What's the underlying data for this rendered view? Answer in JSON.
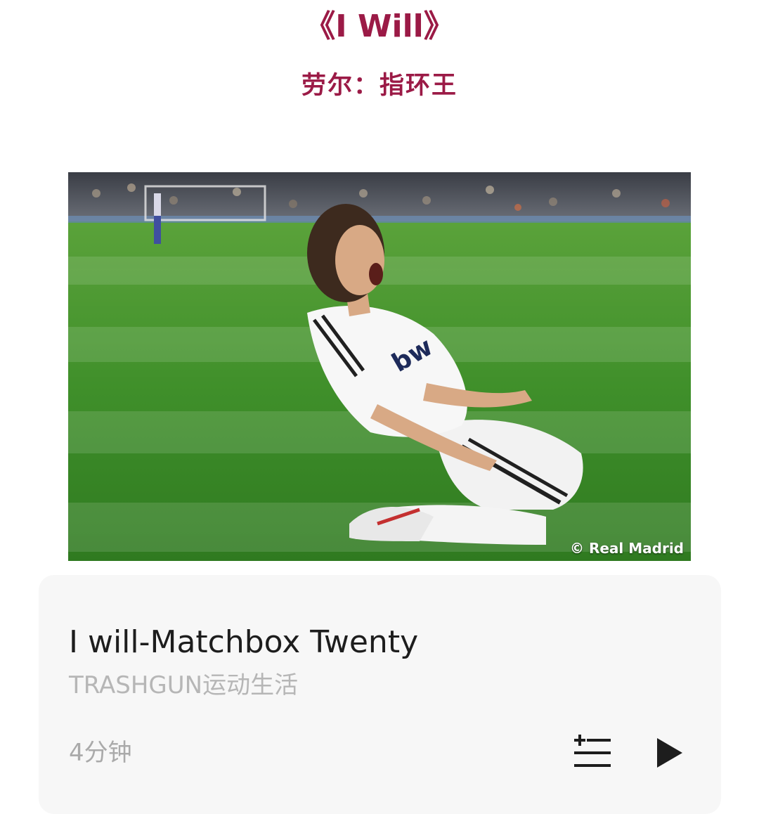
{
  "header": {
    "title": "《I Will》",
    "subtitle": "劳尔：指环王"
  },
  "photo": {
    "credit": "© Real Madrid"
  },
  "music_card": {
    "song_title": "I will-Matchbox Twenty",
    "source": "TRASHGUN运动生活",
    "duration": "4分钟",
    "add_icon": "add-to-playlist-icon",
    "play_icon": "play-icon"
  },
  "colors": {
    "accent": "#9b1a46",
    "card_bg": "#f7f7f7",
    "title_text": "#1d1d1d",
    "muted_text": "#b6b6b6"
  }
}
